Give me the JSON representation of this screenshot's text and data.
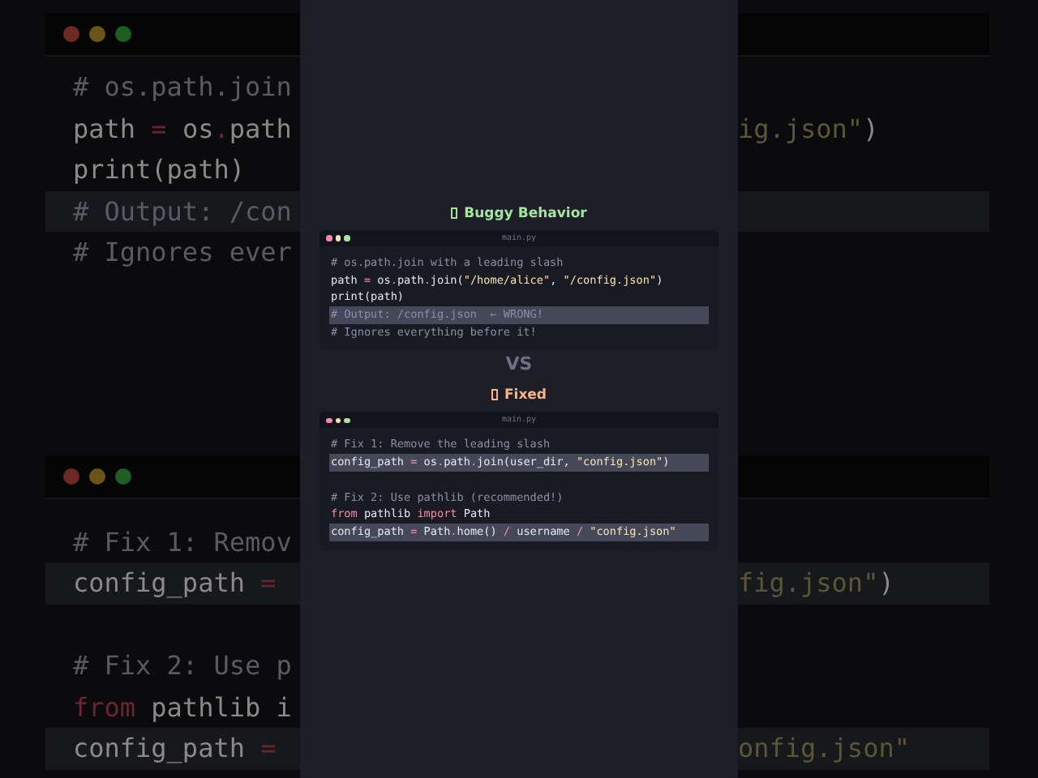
{
  "backdrop": {
    "windows": [
      {
        "rows": [
          {
            "highlighted": false,
            "left": [
              {
                "text": "# os.path.join",
                "kind": "comment"
              }
            ]
          },
          {
            "highlighted": false,
            "left": [
              {
                "text": "path ",
                "kind": "plain"
              },
              {
                "text": "=",
                "kind": "op"
              },
              {
                "text": " os",
                "kind": "plain"
              },
              {
                "text": ".",
                "kind": "op"
              },
              {
                "text": "path",
                "kind": "plain"
              }
            ],
            "right": [
              {
                "text": "ig.json\"",
                "kind": "string"
              },
              {
                "text": ")",
                "kind": "plain"
              }
            ]
          },
          {
            "highlighted": false,
            "left": [
              {
                "text": "print(path)",
                "kind": "plain"
              }
            ]
          },
          {
            "highlighted": true,
            "left": [
              {
                "text": "# Output: /con",
                "kind": "comment"
              }
            ]
          },
          {
            "highlighted": false,
            "left": [
              {
                "text": "# Ignores ever",
                "kind": "comment"
              }
            ]
          }
        ]
      },
      {
        "rows": [
          {
            "highlighted": false,
            "left": [
              {
                "text": "# Fix 1: Remov",
                "kind": "comment"
              }
            ]
          },
          {
            "highlighted": true,
            "left": [
              {
                "text": "config_path ",
                "kind": "plain"
              },
              {
                "text": "=",
                "kind": "op"
              }
            ],
            "right": [
              {
                "text": "fig.json\"",
                "kind": "string"
              },
              {
                "text": ")",
                "kind": "plain"
              }
            ]
          },
          {
            "highlighted": false
          },
          {
            "highlighted": false,
            "left": [
              {
                "text": "# Fix 2: Use p",
                "kind": "comment"
              }
            ]
          },
          {
            "highlighted": false,
            "left": [
              {
                "text": "from",
                "kind": "keyword"
              },
              {
                "text": " pathlib i",
                "kind": "plain"
              }
            ]
          },
          {
            "highlighted": true,
            "left": [
              {
                "text": "config_path ",
                "kind": "plain"
              },
              {
                "text": "=",
                "kind": "op"
              }
            ],
            "right": [
              {
                "text": "onfig.json\"",
                "kind": "string"
              }
            ]
          }
        ]
      }
    ]
  },
  "sections": [
    {
      "title": "Buggy Behavior",
      "kind": "bad",
      "window": {
        "filename": "main.py",
        "lines": [
          {
            "highlighted": false,
            "segments": [
              {
                "text": "# os.path.join with a leading slash",
                "kind": "comment"
              }
            ]
          },
          {
            "highlighted": false,
            "segments": [
              {
                "text": "path ",
                "kind": "plain"
              },
              {
                "text": "=",
                "kind": "op"
              },
              {
                "text": " os",
                "kind": "plain"
              },
              {
                "text": ".",
                "kind": "op"
              },
              {
                "text": "path",
                "kind": "plain"
              },
              {
                "text": ".",
                "kind": "op"
              },
              {
                "text": "join(",
                "kind": "plain"
              },
              {
                "text": "\"/home/alice\"",
                "kind": "string"
              },
              {
                "text": ", ",
                "kind": "plain"
              },
              {
                "text": "\"/config.json\"",
                "kind": "string"
              },
              {
                "text": ")",
                "kind": "plain"
              }
            ]
          },
          {
            "highlighted": false,
            "segments": [
              {
                "text": "print(path)",
                "kind": "plain"
              }
            ]
          },
          {
            "highlighted": true,
            "segments": [
              {
                "text": "# Output: /config.json  ← WRONG!",
                "kind": "comment"
              }
            ]
          },
          {
            "highlighted": false,
            "segments": [
              {
                "text": "# Ignores everything before it!",
                "kind": "comment"
              }
            ]
          }
        ]
      }
    },
    {
      "separator": "VS"
    },
    {
      "title": "Fixed",
      "kind": "good",
      "window": {
        "filename": "main.py",
        "lines": [
          {
            "highlighted": false,
            "segments": [
              {
                "text": "# Fix 1: Remove the leading slash",
                "kind": "comment"
              }
            ]
          },
          {
            "highlighted": true,
            "segments": [
              {
                "text": "config_path ",
                "kind": "plain"
              },
              {
                "text": "=",
                "kind": "op"
              },
              {
                "text": " os",
                "kind": "plain"
              },
              {
                "text": ".",
                "kind": "op"
              },
              {
                "text": "path",
                "kind": "plain"
              },
              {
                "text": ".",
                "kind": "op"
              },
              {
                "text": "join(user_dir, ",
                "kind": "plain"
              },
              {
                "text": "\"config.json\"",
                "kind": "string"
              },
              {
                "text": ")",
                "kind": "plain"
              }
            ]
          },
          {
            "highlighted": false
          },
          {
            "highlighted": false,
            "segments": [
              {
                "text": "# Fix 2: Use pathlib (recommended!)",
                "kind": "comment"
              }
            ]
          },
          {
            "highlighted": false,
            "segments": [
              {
                "text": "from",
                "kind": "keyword"
              },
              {
                "text": " pathlib ",
                "kind": "plain"
              },
              {
                "text": "import",
                "kind": "keyword"
              },
              {
                "text": " Path",
                "kind": "plain"
              }
            ]
          },
          {
            "highlighted": true,
            "segments": [
              {
                "text": "config_path ",
                "kind": "plain"
              },
              {
                "text": "=",
                "kind": "op"
              },
              {
                "text": " Path",
                "kind": "plain"
              },
              {
                "text": ".",
                "kind": "op"
              },
              {
                "text": "home() ",
                "kind": "plain"
              },
              {
                "text": "/",
                "kind": "op"
              },
              {
                "text": " username ",
                "kind": "plain"
              },
              {
                "text": "/ ",
                "kind": "op"
              },
              {
                "text": "\"config.json\"",
                "kind": "string"
              }
            ]
          }
        ]
      }
    }
  ]
}
